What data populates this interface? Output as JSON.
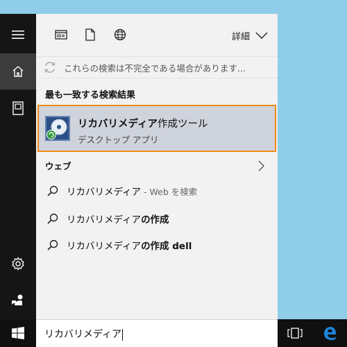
{
  "rail": {
    "items": [
      {
        "icon": "hamburger-menu-icon"
      },
      {
        "icon": "home-icon",
        "active": true
      },
      {
        "icon": "notebook-icon"
      },
      {
        "icon": "settings-gear-icon"
      },
      {
        "icon": "feedback-icon"
      }
    ]
  },
  "toolbar": {
    "filters": [
      {
        "icon": "apps-filter-icon"
      },
      {
        "icon": "documents-filter-icon"
      },
      {
        "icon": "web-filter-icon"
      }
    ],
    "details_label": "詳細"
  },
  "status": {
    "text": "これらの検索は不完全である場合があります..."
  },
  "best_match": {
    "header": "最も一致する検索結果",
    "title_bold": "リカバリメディア",
    "title_rest": "作成ツール",
    "subtitle": "デスクトップ アプリ",
    "highlight_color": "#f08a14"
  },
  "web": {
    "header": "ウェブ",
    "results": [
      {
        "query": "リカバリメディア",
        "suffix": " - Web を検索"
      },
      {
        "query": "リカバリメディア",
        "bold": "の作成"
      },
      {
        "query": "リカバリメディア",
        "bold": "の作成 dell"
      }
    ]
  },
  "search": {
    "value": "リカバリメディア"
  },
  "colors": {
    "rail_bg": "#151515",
    "panel_bg": "#f2f2f2",
    "desktop_bg": "#8fcde8",
    "edge_blue": "#1e84d8"
  }
}
